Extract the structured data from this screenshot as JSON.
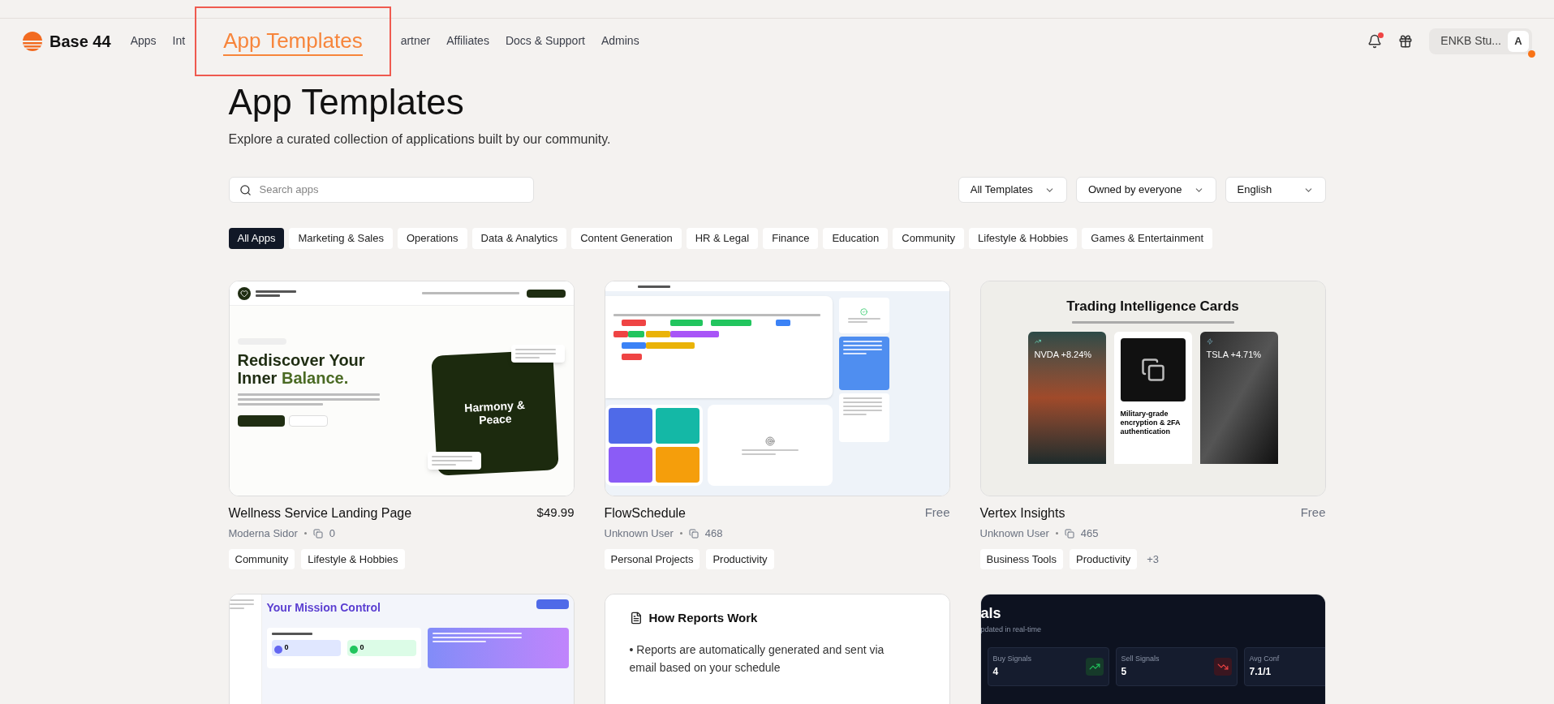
{
  "header": {
    "logo": "Base 44",
    "nav": [
      {
        "label": "Apps",
        "selected": false
      },
      {
        "label": "Int",
        "selected": false
      },
      {
        "label": "App Templates",
        "selected": true
      },
      {
        "label": "artner",
        "selected": false
      },
      {
        "label": "Affiliates",
        "selected": false
      },
      {
        "label": "Docs & Support",
        "selected": false
      },
      {
        "label": "Admins",
        "selected": false
      }
    ],
    "notifications_unread": true,
    "user": {
      "name": "ENKB Stu...",
      "avatar": "A"
    }
  },
  "page": {
    "title": "App Templates",
    "subtitle": "Explore a curated collection of applications built by our community."
  },
  "search": {
    "placeholder": "Search apps"
  },
  "filters": [
    "All Templates",
    "Owned by everyone",
    "English"
  ],
  "categories": [
    {
      "label": "All Apps",
      "selected": true
    },
    {
      "label": "Marketing & Sales",
      "selected": false
    },
    {
      "label": "Operations",
      "selected": false
    },
    {
      "label": "Data & Analytics",
      "selected": false
    },
    {
      "label": "Content Generation",
      "selected": false
    },
    {
      "label": "HR & Legal",
      "selected": false
    },
    {
      "label": "Finance",
      "selected": false
    },
    {
      "label": "Education",
      "selected": false
    },
    {
      "label": "Community",
      "selected": false
    },
    {
      "label": "Lifestyle & Hobbies",
      "selected": false
    },
    {
      "label": "Games & Entertainment",
      "selected": false
    }
  ],
  "cards": [
    {
      "kind": "wellness",
      "title": "Wellness Service Landing Page",
      "price": "$49.99",
      "author": "Moderna Sidor",
      "uses": "0",
      "tags": [
        "Community",
        "Lifestyle & Hobbies"
      ],
      "preview": {
        "heading": "Rediscover Your Inner",
        "heading_accent": "Balance.",
        "motto": "Harmony & Peace"
      }
    },
    {
      "kind": "schedule",
      "title": "FlowSchedule",
      "price": "Free",
      "author": "Unknown User",
      "uses": "468",
      "tags": [
        "Personal Projects",
        "Productivity"
      ]
    },
    {
      "kind": "trading",
      "title": "Vertex Insights",
      "price": "Free",
      "author": "Unknown User",
      "uses": "465",
      "tags": [
        "Business Tools",
        "Productivity"
      ],
      "more": "+3",
      "preview": {
        "heading": "Trading Intelligence Cards",
        "left": "NVDA +8.24%",
        "right": "TSLA +4.71%",
        "feature": "Military-grade encryption & 2FA authentication"
      }
    },
    {
      "kind": "mission",
      "preview": {
        "heading": "Your Mission Control",
        "stats": [
          "0",
          "0"
        ]
      }
    },
    {
      "kind": "reports",
      "preview": {
        "heading": "How Reports Work",
        "bullet": "• Reports are automatically generated and sent via email based on your schedule"
      }
    },
    {
      "kind": "signals",
      "preview": {
        "heading": "als",
        "sub": "pdated in real-time",
        "stats": [
          {
            "label": "Buy Signals",
            "value": "4",
            "kind": "up"
          },
          {
            "label": "Sell Signals",
            "value": "5",
            "kind": "down"
          },
          {
            "label": "Avg Conf",
            "value": "7.1/1",
            "kind": "plain"
          }
        ]
      }
    }
  ]
}
